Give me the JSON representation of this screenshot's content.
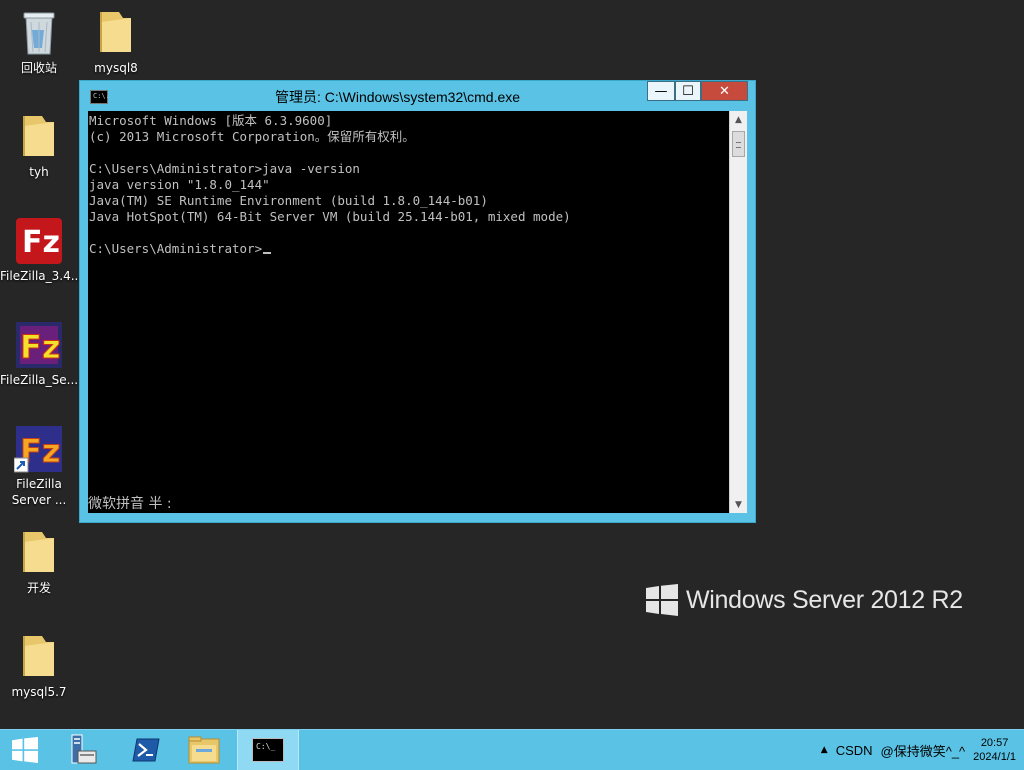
{
  "desktop": {
    "icons": [
      {
        "label": "回收站",
        "icon": "recycle-bin-icon"
      },
      {
        "label": "mysql8",
        "icon": "folder-icon"
      },
      {
        "label": "tyh",
        "icon": "folder-icon"
      },
      {
        "label": "FileZilla_3.4...",
        "icon": "filezilla-client-icon"
      },
      {
        "label": "FileZilla_Se...",
        "icon": "filezilla-server-icon"
      },
      {
        "label": "FileZilla Server ...",
        "icon": "filezilla-server-shortcut-icon"
      },
      {
        "label": "开发",
        "icon": "folder-icon"
      },
      {
        "label": "mysql5.7",
        "icon": "folder-icon"
      }
    ],
    "watermark": "Windows Server 2012 R2"
  },
  "cmd_window": {
    "title": "管理员: C:\\Windows\\system32\\cmd.exe",
    "title_icon_text": "C:\\.",
    "minimize_label": "—",
    "maximize_label": "☐",
    "close_label": "✕",
    "lines": [
      "Microsoft Windows [版本 6.3.9600]",
      "(c) 2013 Microsoft Corporation。保留所有权利。",
      "",
      "C:\\Users\\Administrator>java -version",
      "java version \"1.8.0_144\"",
      "Java(TM) SE Runtime Environment (build 1.8.0_144-b01)",
      "Java HotSpot(TM) 64-Bit Server VM (build 25.144-b01, mixed mode)",
      "",
      "C:\\Users\\Administrator>"
    ],
    "ime_status": "微软拼音 半 :"
  },
  "taskbar": {
    "items": [
      "start-icon",
      "server-manager-icon",
      "powershell-icon",
      "file-explorer-icon",
      "cmd-taskbar-icon"
    ],
    "cmd_icon_text": "C:\\_",
    "tray": {
      "expand_label": "▲",
      "items": [
        "CSDN",
        "@保持微笑^_^"
      ],
      "time": "20:57",
      "date": "2024/1/1"
    }
  }
}
